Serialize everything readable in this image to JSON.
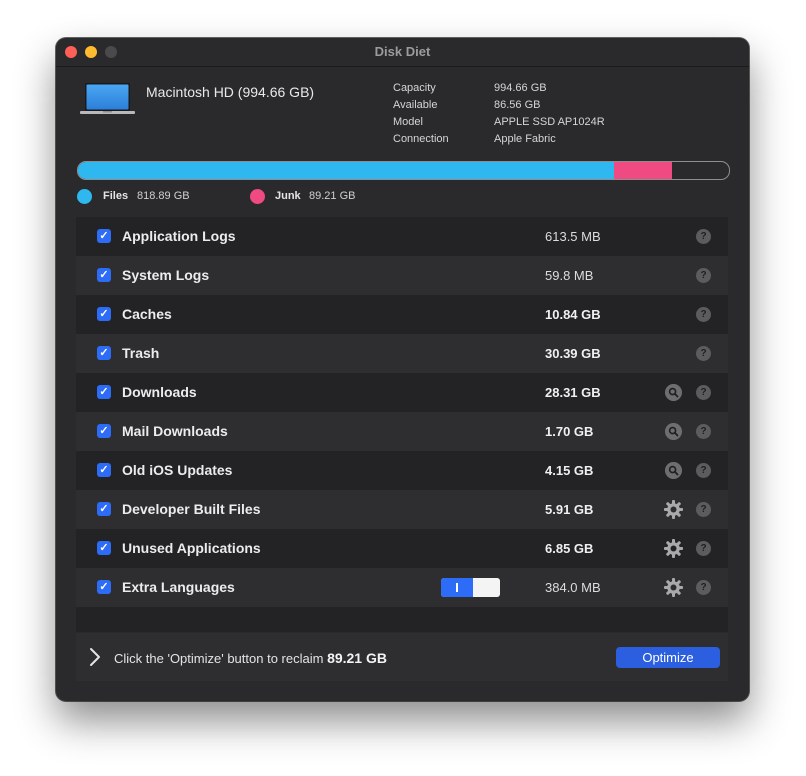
{
  "window": {
    "title": "Disk Diet"
  },
  "disk": {
    "name": "Macintosh HD (994.66 GB)",
    "info": [
      {
        "label": "Capacity",
        "value": "994.66 GB"
      },
      {
        "label": "Available",
        "value": "86.56 GB"
      },
      {
        "label": "Model",
        "value": "APPLE SSD AP1024R"
      },
      {
        "label": "Connection",
        "value": "Apple Fabric"
      }
    ]
  },
  "usage": {
    "files_fraction": 0.823,
    "junk_fraction": 0.0897,
    "files_color": "#2fb8ef",
    "junk_color": "#ef4a82"
  },
  "legend": {
    "files_label": "Files",
    "files_value": "818.89 GB",
    "junk_label": "Junk",
    "junk_value": "89.21 GB"
  },
  "items": [
    {
      "label": "Application Logs",
      "size": "613.5 MB",
      "checked": true,
      "action": "none"
    },
    {
      "label": "System Logs",
      "size": "59.8 MB",
      "checked": true,
      "action": "none"
    },
    {
      "label": "Caches",
      "size": "10.84 GB",
      "checked": true,
      "action": "none"
    },
    {
      "label": "Trash",
      "size": "30.39 GB",
      "checked": true,
      "action": "none"
    },
    {
      "label": "Downloads",
      "size": "28.31 GB",
      "checked": true,
      "action": "magnifier-icon"
    },
    {
      "label": "Mail Downloads",
      "size": "1.70 GB",
      "checked": true,
      "action": "magnifier-icon"
    },
    {
      "label": "Old iOS Updates",
      "size": "4.15 GB",
      "checked": true,
      "action": "magnifier-icon"
    },
    {
      "label": "Developer Built Files",
      "size": "5.91 GB",
      "checked": true,
      "action": "gear-icon"
    },
    {
      "label": "Unused Applications",
      "size": "6.85 GB",
      "checked": true,
      "action": "gear-icon"
    },
    {
      "label": "Extra Languages",
      "size": "384.0 MB",
      "checked": true,
      "action": "gear-icon"
    }
  ],
  "help_glyph": "?",
  "checkmark_glyph": "✓",
  "footer": {
    "text": "Click the 'Optimize' button to reclaim",
    "amount": "89.21 GB",
    "button_label": "Optimize"
  }
}
